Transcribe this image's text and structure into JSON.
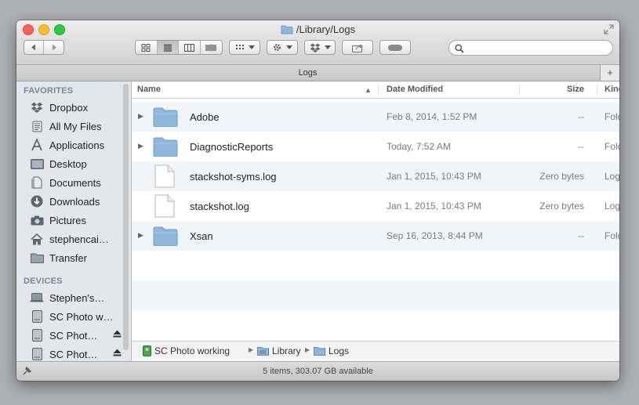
{
  "window": {
    "title": "/Library/Logs"
  },
  "tab": {
    "label": "Logs"
  },
  "toolbar": {
    "back_icon": "chevron-left-icon",
    "forward_icon": "chevron-right-icon",
    "views": [
      "icon-view-icon",
      "list-view-icon",
      "column-view-icon",
      "coverflow-view-icon"
    ],
    "arrange_icon": "arrange-grid-icon",
    "action_icon": "gear-icon",
    "dropbox_icon": "dropbox-icon",
    "share_icon": "share-icon",
    "tags_icon": "tag-pill-icon",
    "search_placeholder": ""
  },
  "sidebar": {
    "favorites_heading": "FAVORITES",
    "favorites": [
      {
        "label": "Dropbox",
        "icon": "dropbox-icon"
      },
      {
        "label": "All My Files",
        "icon": "all-files-icon"
      },
      {
        "label": "Applications",
        "icon": "applications-icon"
      },
      {
        "label": "Desktop",
        "icon": "desktop-icon"
      },
      {
        "label": "Documents",
        "icon": "documents-icon"
      },
      {
        "label": "Downloads",
        "icon": "downloads-icon"
      },
      {
        "label": "Pictures",
        "icon": "camera-icon"
      },
      {
        "label": "stephencai…",
        "icon": "home-icon"
      },
      {
        "label": "Transfer",
        "icon": "folder-icon"
      }
    ],
    "devices_heading": "DEVICES",
    "devices": [
      {
        "label": "Stephen's…",
        "icon": "laptop-icon",
        "eject": false
      },
      {
        "label": "SC Photo w…",
        "icon": "drive-icon",
        "eject": false
      },
      {
        "label": "SC Phot…",
        "icon": "drive-icon",
        "eject": true
      },
      {
        "label": "SC Phot…",
        "icon": "drive-icon",
        "eject": true
      }
    ]
  },
  "columns": {
    "name": "Name",
    "date": "Date Modified",
    "size": "Size",
    "kind": "Kind"
  },
  "files": [
    {
      "name": "Adobe",
      "date": "Feb 8, 2014, 1:52 PM",
      "size": "--",
      "kind": "Folder",
      "type": "folder"
    },
    {
      "name": "DiagnosticReports",
      "date": "Today, 7:52 AM",
      "size": "--",
      "kind": "Folder",
      "type": "folder"
    },
    {
      "name": "stackshot-syms.log",
      "date": "Jan 1, 2015, 10:43 PM",
      "size": "Zero bytes",
      "kind": "Log File",
      "type": "file"
    },
    {
      "name": "stackshot.log",
      "date": "Jan 1, 2015, 10:43 PM",
      "size": "Zero bytes",
      "kind": "Log File",
      "type": "file"
    },
    {
      "name": "Xsan",
      "date": "Sep 16, 2013, 8:44 PM",
      "size": "--",
      "kind": "Folder",
      "type": "folder"
    }
  ],
  "pathbar": [
    "SC Photo working",
    "Library",
    "Logs"
  ],
  "status": {
    "text": "5 items, 303.07 GB available"
  },
  "colors": {
    "sidebar_bg": "#e3e7ec",
    "row_alt": "#f2f5f8",
    "folder_blue": "#8fb7dc"
  }
}
